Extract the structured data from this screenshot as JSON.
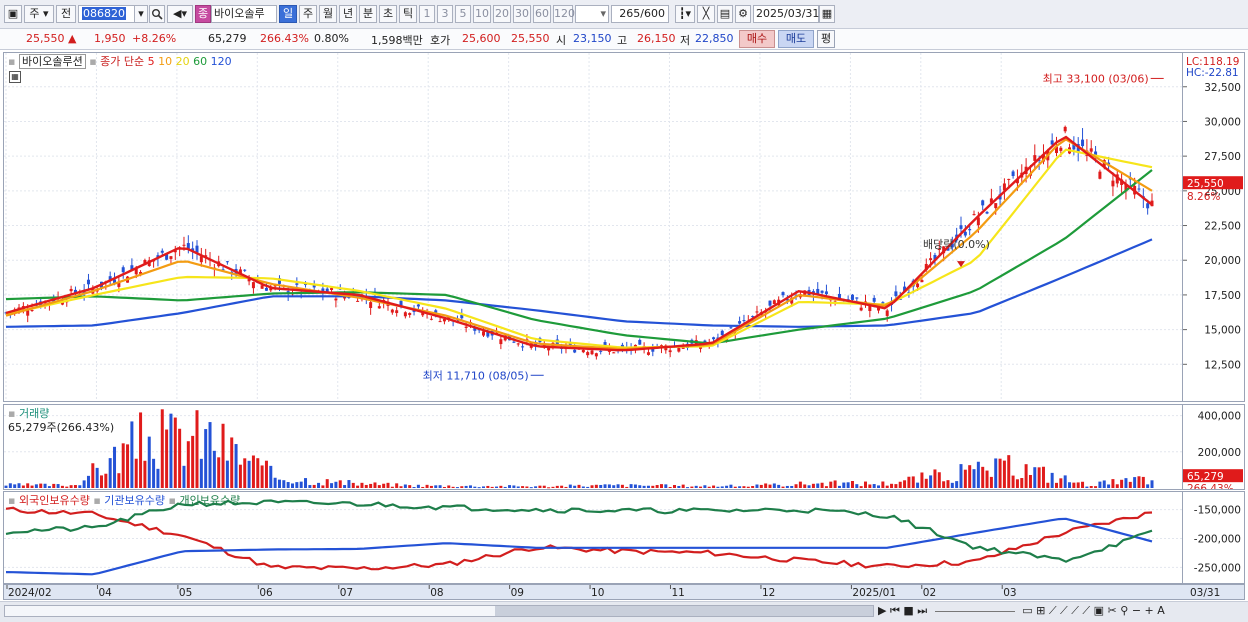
{
  "toolbar": {
    "market": "주",
    "prev_label": "전",
    "code": "086820",
    "company": "바이오솔루",
    "company_badge": "종",
    "periods": [
      "일",
      "주",
      "월",
      "년",
      "분",
      "초",
      "틱"
    ],
    "intervals": [
      "1",
      "3",
      "5",
      "10",
      "20",
      "30",
      "60",
      "120"
    ],
    "count_value": "265",
    "count_total": "/600",
    "date": "2025/03/31"
  },
  "quote": {
    "price": "25,550",
    "arrow": "▲",
    "change": "1,950",
    "change_pct": "+8.26%",
    "volume": "65,279",
    "volume_pct": "266.43%",
    "turnover": "0.80%",
    "amount": "1,598백만",
    "ask_label": "호가",
    "ask": "25,600",
    "bid": "25,550",
    "open_label": "시",
    "open": "23,150",
    "high_label": "고",
    "high": "26,150",
    "low_label": "저",
    "low": "22,850",
    "buy_label": "매수",
    "sell_label": "매도",
    "eval_label": "평"
  },
  "price_pane": {
    "legend_name": "바이오솔루션",
    "legend_type": "종가 단순",
    "ma_labels": [
      "5",
      "10",
      "20",
      "60",
      "120"
    ],
    "ma_colors": [
      "#e01b1b",
      "#f39c12",
      "#f6e51a",
      "#1e9b3a",
      "#2452d6"
    ],
    "lc_label": "LC:118.19",
    "hc_label": "HC:-22.81",
    "high_annotation": "최고 33,100 (03/06)",
    "low_annotation": "최저 11,710 (08/05)",
    "dividend_annotation": "배당락(0.0%)",
    "current_price_tag": "25,550",
    "current_pct_tag": "8.26%"
  },
  "volume_pane": {
    "legend_name": "거래량",
    "legend_value": "65,279주(266.43%)",
    "current_tag": "65,279",
    "current_pct_tag": "266.43%"
  },
  "holdings_pane": {
    "legend_foreign": "외국인보유수량",
    "legend_institution": "기관보유수량",
    "legend_individual": "개인보유수량"
  },
  "x_axis": {
    "labels": [
      "2024/02",
      "04",
      "05",
      "06",
      "07",
      "08",
      "09",
      "10",
      "11",
      "12",
      "2025/01",
      "02",
      "03"
    ],
    "right_label": "03/31"
  },
  "chart_data": [
    {
      "type": "line",
      "title": "바이오솔루션",
      "ylim": [
        10000,
        34500
      ],
      "y_ticks": [
        12500,
        15000,
        17500,
        20000,
        22500,
        25000,
        27500,
        30000,
        32500
      ],
      "x_ticks": [
        "2024/02",
        "04",
        "05",
        "06",
        "07",
        "08",
        "09",
        "10",
        "11",
        "12",
        "2025/01",
        "02",
        "03"
      ],
      "x": [
        "2024/02",
        "2024/03",
        "2024/04",
        "2024/05",
        "2024/06",
        "2024/07",
        "2024/08",
        "2024/09",
        "2024/10",
        "2024/11",
        "2024/12",
        "2025/01",
        "2025/02",
        "2025/03"
      ],
      "series": [
        {
          "name": "5",
          "values": [
            16200,
            18000,
            21000,
            18000,
            17500,
            15800,
            13800,
            13500,
            14000,
            17800,
            16500,
            23000,
            29000,
            24000
          ]
        },
        {
          "name": "10",
          "values": [
            16000,
            17800,
            20000,
            18300,
            17300,
            16000,
            14000,
            13600,
            13900,
            17500,
            16700,
            22000,
            28800,
            25000
          ]
        },
        {
          "name": "20",
          "values": [
            16100,
            17500,
            18800,
            18700,
            17800,
            16500,
            14300,
            13700,
            13800,
            17000,
            16800,
            20000,
            28000,
            26700
          ]
        },
        {
          "name": "60",
          "values": [
            17200,
            17400,
            17100,
            17600,
            17700,
            17500,
            15700,
            14600,
            14000,
            15000,
            15800,
            17800,
            21500,
            26500
          ]
        },
        {
          "name": "120",
          "values": [
            15200,
            15300,
            16200,
            17400,
            17400,
            17100,
            16400,
            15600,
            15300,
            15200,
            15300,
            16200,
            18800,
            21500
          ]
        }
      ],
      "annotations": [
        {
          "text": "최고 33,100 (03/06)",
          "x": "2025/03/06",
          "y": 33100
        },
        {
          "text": "최저 11,710 (08/05)",
          "x": "2024/08/05",
          "y": 11710
        },
        {
          "text": "배당락(0.0%)",
          "x": "2024/12/26",
          "y": 19500
        }
      ],
      "last": {
        "price": 25550,
        "change_pct": "8.26%"
      }
    },
    {
      "type": "bar",
      "title": "거래량",
      "ylim": [
        0,
        420000
      ],
      "y_ticks": [
        200000,
        400000
      ],
      "values": [
        24000,
        22000,
        380000,
        410000,
        90000,
        40000,
        20000,
        16000,
        14000,
        22000,
        18000,
        16000,
        38000,
        36000,
        110000,
        170000,
        30000,
        65279
      ],
      "last": {
        "volume": 65279,
        "pct": "266.43%"
      }
    },
    {
      "type": "line",
      "title": "보유수량",
      "ylim": [
        -270000,
        -130000
      ],
      "y_ticks": [
        -150000,
        -200000,
        -250000
      ],
      "series": [
        {
          "name": "외국인보유수량",
          "values": [
            -150000,
            -158000,
            -195000,
            -250000,
            -252000,
            -245000,
            -215000,
            -222000,
            -225000,
            -238000,
            -248000,
            -240000,
            -190000,
            -155000
          ]
        },
        {
          "name": "기관보유수량",
          "values": [
            -258000,
            -262000,
            -222000,
            -219000,
            -218000,
            -208000,
            -216000,
            -216000,
            -216000,
            -216000,
            -216000,
            -190000,
            -165000,
            -205000
          ]
        },
        {
          "name": "개인보유수량",
          "values": [
            -188000,
            -182000,
            -140000,
            -138000,
            -140000,
            -146000,
            -150000,
            -152000,
            -152000,
            -150000,
            -160000,
            -215000,
            -238000,
            -190000
          ]
        }
      ]
    }
  ]
}
